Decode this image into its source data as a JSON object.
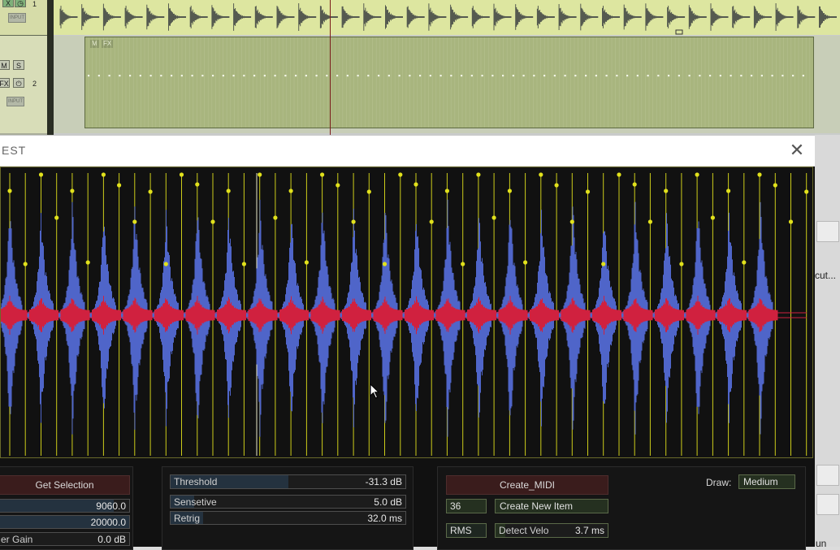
{
  "daw": {
    "tracks": [
      {
        "number": "1",
        "buttons": [
          "X",
          "◷"
        ],
        "input_label": "INPUT"
      },
      {
        "number": "2",
        "buttons": [
          "M",
          "S",
          "FX",
          "⏻"
        ],
        "input_label": "INPUT"
      }
    ],
    "midi_item": {
      "tags": [
        "M",
        "FX"
      ]
    },
    "right_strip": {
      "cut_label": "cut...",
      "bottom_label": "un"
    }
  },
  "window": {
    "title": "EST",
    "close_glyph": "✕"
  },
  "controls": {
    "left": {
      "get_selection": "Get Selection",
      "value1": "9060.0",
      "value2": "20000.0",
      "gain_label": "er Gain",
      "gain_value": "0.0 dB"
    },
    "middle": {
      "threshold": {
        "label": "Threshold",
        "value": "-31.3 dB",
        "level": 0.5
      },
      "sensetive": {
        "label": "Sensetive",
        "value": "5.0 dB",
        "level": 0.1
      },
      "retrig": {
        "label": "Retrig",
        "value": "32.0 ms",
        "level": 0.14
      }
    },
    "right": {
      "create_midi": "Create_MIDI",
      "note": "36",
      "create_new_item": "Create New Item",
      "rms": "RMS",
      "detect_velo_label": "Detect Velo",
      "detect_velo_value": "3.7 ms",
      "draw_label": "Draw:",
      "draw_value": "Medium"
    }
  },
  "colors": {
    "waveform_blue": "#4f65c9",
    "waveform_red": "#d0213f",
    "marker_yellow": "#e1e11c",
    "button_red": "#3a1c1c",
    "fill_blue": "#24323f"
  }
}
